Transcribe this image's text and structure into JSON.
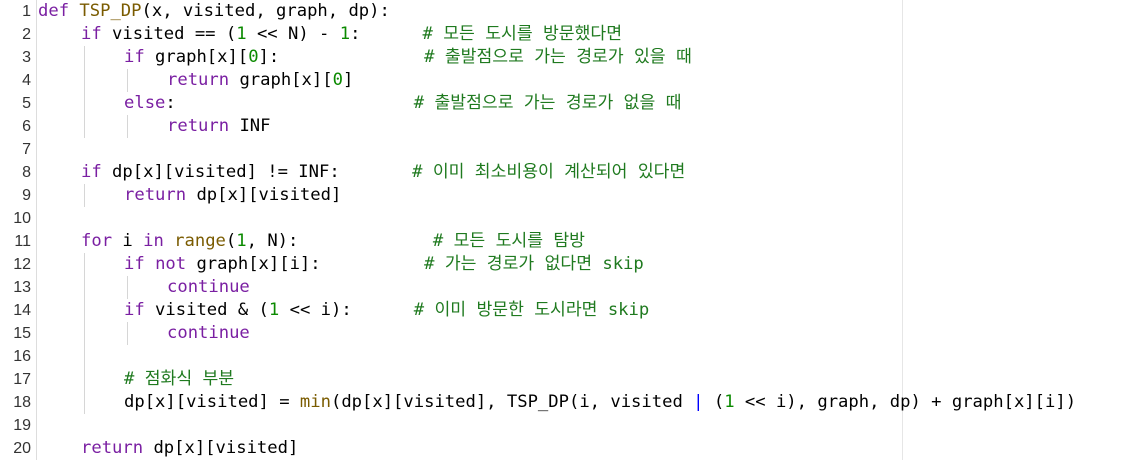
{
  "editor": {
    "colors": {
      "keyword": "#7a1fa2",
      "builtin": "#7a5b00",
      "function_name": "#5b2db8",
      "number": "#0b8a00",
      "comment": "#1f7a1f",
      "text": "#000000",
      "line_number": "#333333"
    },
    "lines": [
      {
        "number": "1",
        "indent": 0,
        "tokens": [
          {
            "t": "def",
            "c": "kw"
          },
          {
            "t": " ",
            "c": "plain"
          },
          {
            "t": "TSP_DP",
            "c": "fn"
          },
          {
            "t": "(x, visited, graph, dp):",
            "c": "plain"
          }
        ]
      },
      {
        "number": "2",
        "indent": 1,
        "tokens": [
          {
            "t": "if",
            "c": "kw"
          },
          {
            "t": " visited == (",
            "c": "plain"
          },
          {
            "t": "1",
            "c": "num"
          },
          {
            "t": " << N) - ",
            "c": "plain"
          },
          {
            "t": "1",
            "c": "num"
          },
          {
            "t": ":",
            "c": "plain"
          },
          {
            "t": "      # 모든 도시를 방문했다면",
            "c": "cm"
          }
        ]
      },
      {
        "number": "3",
        "indent": 2,
        "tokens": [
          {
            "t": "if",
            "c": "kw"
          },
          {
            "t": " graph[x][",
            "c": "plain"
          },
          {
            "t": "0",
            "c": "num"
          },
          {
            "t": "]:",
            "c": "plain"
          },
          {
            "t": "              # 출발점으로 가는 경로가 있을 때",
            "c": "cm"
          }
        ]
      },
      {
        "number": "4",
        "indent": 3,
        "tokens": [
          {
            "t": "return",
            "c": "kw"
          },
          {
            "t": " graph[x][",
            "c": "plain"
          },
          {
            "t": "0",
            "c": "num"
          },
          {
            "t": "]",
            "c": "plain"
          }
        ]
      },
      {
        "number": "5",
        "indent": 2,
        "tokens": [
          {
            "t": "else",
            "c": "kw"
          },
          {
            "t": ":",
            "c": "plain"
          },
          {
            "t": "                       # 출발점으로 가는 경로가 없을 때",
            "c": "cm"
          }
        ]
      },
      {
        "number": "6",
        "indent": 3,
        "tokens": [
          {
            "t": "return",
            "c": "kw"
          },
          {
            "t": " INF",
            "c": "plain"
          }
        ]
      },
      {
        "number": "7",
        "indent": 1,
        "tokens": []
      },
      {
        "number": "8",
        "indent": 1,
        "tokens": [
          {
            "t": "if",
            "c": "kw"
          },
          {
            "t": " dp[x][visited] != INF:",
            "c": "plain"
          },
          {
            "t": "       # 이미 최소비용이 계산되어 있다면",
            "c": "cm"
          }
        ]
      },
      {
        "number": "9",
        "indent": 2,
        "tokens": [
          {
            "t": "return",
            "c": "kw"
          },
          {
            "t": " dp[x][visited]",
            "c": "plain"
          }
        ]
      },
      {
        "number": "10",
        "indent": 1,
        "tokens": []
      },
      {
        "number": "11",
        "indent": 1,
        "tokens": [
          {
            "t": "for",
            "c": "kw"
          },
          {
            "t": " i ",
            "c": "plain"
          },
          {
            "t": "in",
            "c": "kw"
          },
          {
            "t": " ",
            "c": "plain"
          },
          {
            "t": "range",
            "c": "fn"
          },
          {
            "t": "(",
            "c": "plain"
          },
          {
            "t": "1",
            "c": "num"
          },
          {
            "t": ", N):",
            "c": "plain"
          },
          {
            "t": "             # 모든 도시를 탐방",
            "c": "cm"
          }
        ]
      },
      {
        "number": "12",
        "indent": 2,
        "tokens": [
          {
            "t": "if",
            "c": "kw"
          },
          {
            "t": " ",
            "c": "plain"
          },
          {
            "t": "not",
            "c": "kw"
          },
          {
            "t": " graph[x][i]:",
            "c": "plain"
          },
          {
            "t": "          # 가는 경로가 없다면 skip",
            "c": "cm"
          }
        ]
      },
      {
        "number": "13",
        "indent": 3,
        "tokens": [
          {
            "t": "continue",
            "c": "kw"
          }
        ]
      },
      {
        "number": "14",
        "indent": 2,
        "tokens": [
          {
            "t": "if",
            "c": "kw"
          },
          {
            "t": " visited & (",
            "c": "plain"
          },
          {
            "t": "1",
            "c": "num"
          },
          {
            "t": " << i):",
            "c": "plain"
          },
          {
            "t": "      # 이미 방문한 도시라면 skip",
            "c": "cm"
          }
        ]
      },
      {
        "number": "15",
        "indent": 3,
        "tokens": [
          {
            "t": "continue",
            "c": "kw"
          }
        ]
      },
      {
        "number": "16",
        "indent": 2,
        "tokens": []
      },
      {
        "number": "17",
        "indent": 2,
        "tokens": [
          {
            "t": "# 점화식 부분",
            "c": "cm"
          }
        ]
      },
      {
        "number": "18",
        "indent": 2,
        "tokens": [
          {
            "t": "dp[x][visited] = ",
            "c": "plain"
          },
          {
            "t": "min",
            "c": "fn"
          },
          {
            "t": "(dp[x][visited], TSP_DP(i, visited ",
            "c": "plain"
          },
          {
            "t": "|",
            "c": "cursor"
          },
          {
            "t": " (",
            "c": "plain"
          },
          {
            "t": "1",
            "c": "num"
          },
          {
            "t": " << i), graph, dp) + graph[x][i])",
            "c": "plain"
          }
        ]
      },
      {
        "number": "19",
        "indent": 1,
        "tokens": []
      },
      {
        "number": "20",
        "indent": 1,
        "tokens": [
          {
            "t": "return",
            "c": "kw"
          },
          {
            "t": " dp[x][visited]",
            "c": "plain"
          }
        ]
      }
    ]
  }
}
